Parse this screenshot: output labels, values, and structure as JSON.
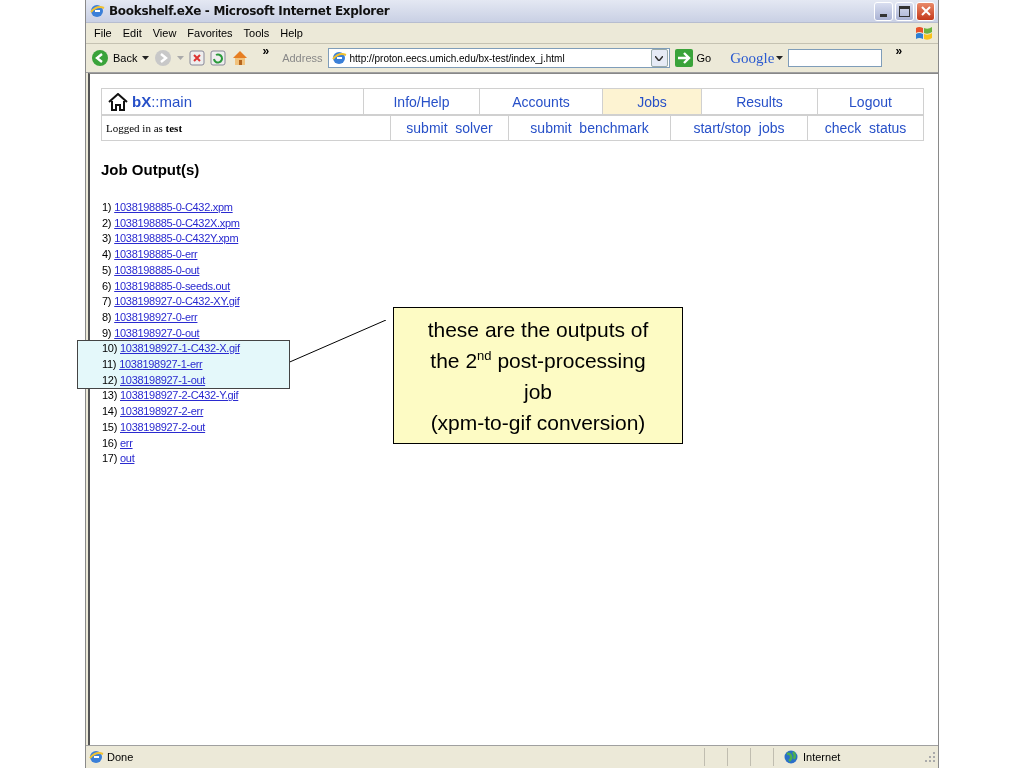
{
  "window": {
    "title": "Bookshelf.eXe - Microsoft Internet Explorer"
  },
  "menu": [
    "File",
    "Edit",
    "View",
    "Favorites",
    "Tools",
    "Help"
  ],
  "toolbar": {
    "back": "Back",
    "chevron": "»",
    "address_label": "Address",
    "url": "http://proton.eecs.umich.edu/bx-test/index_j.html",
    "go": "Go",
    "search_brand": "Google",
    "search_chevron": "»"
  },
  "nav": {
    "brand": "**bX**::main",
    "tabs": [
      {
        "label": "Info/Help",
        "selected": false
      },
      {
        "label": "Accounts",
        "selected": false
      },
      {
        "label": "Jobs",
        "selected": true
      },
      {
        "label": "Results",
        "selected": false
      },
      {
        "label": "Logout",
        "selected": false
      }
    ],
    "login": "Logged in as **test**",
    "actions": [
      "submit  solver",
      "submit  benchmark",
      "start/stop  jobs",
      "check  status"
    ]
  },
  "heading": "Job Output(s)",
  "outputs": [
    {
      "number": "1)",
      "name": "1038198885-0-C432.xpm",
      "highlighted": false
    },
    {
      "number": "2)",
      "name": "1038198885-0-C432X.xpm",
      "highlighted": false
    },
    {
      "number": "3)",
      "name": "1038198885-0-C432Y.xpm",
      "highlighted": false
    },
    {
      "number": "4)",
      "name": "1038198885-0-err",
      "highlighted": false
    },
    {
      "number": "5)",
      "name": "1038198885-0-out",
      "highlighted": false
    },
    {
      "number": "6)",
      "name": "1038198885-0-seeds.out",
      "highlighted": false
    },
    {
      "number": "7)",
      "name": "1038198927-0-C432-XY.gif",
      "highlighted": false
    },
    {
      "number": "8)",
      "name": "1038198927-0-err",
      "highlighted": false
    },
    {
      "number": "9)",
      "name": "1038198927-0-out",
      "highlighted": false
    },
    {
      "number": "10)",
      "name": "1038198927-1-C432-X.gif",
      "highlighted": true
    },
    {
      "number": "11)",
      "name": "1038198927-1-err",
      "highlighted": true
    },
    {
      "number": "12)",
      "name": "1038198927-1-out",
      "highlighted": true
    },
    {
      "number": "13)",
      "name": "1038198927-2-C432-Y.gif",
      "highlighted": false
    },
    {
      "number": "14)",
      "name": "1038198927-2-err",
      "highlighted": false
    },
    {
      "number": "15)",
      "name": "1038198927-2-out",
      "highlighted": false
    },
    {
      "number": "16)",
      "name": "err",
      "highlighted": false
    },
    {
      "number": "17)",
      "name": "out",
      "highlighted": false
    }
  ],
  "annotation": {
    "lines": [
      "these are the outputs of",
      "the 2$^{nd}$ post-processing",
      "job",
      "(xpm-to-gif conversion)"
    ]
  },
  "status_bar": {
    "text": "Done",
    "zone": "Internet"
  }
}
